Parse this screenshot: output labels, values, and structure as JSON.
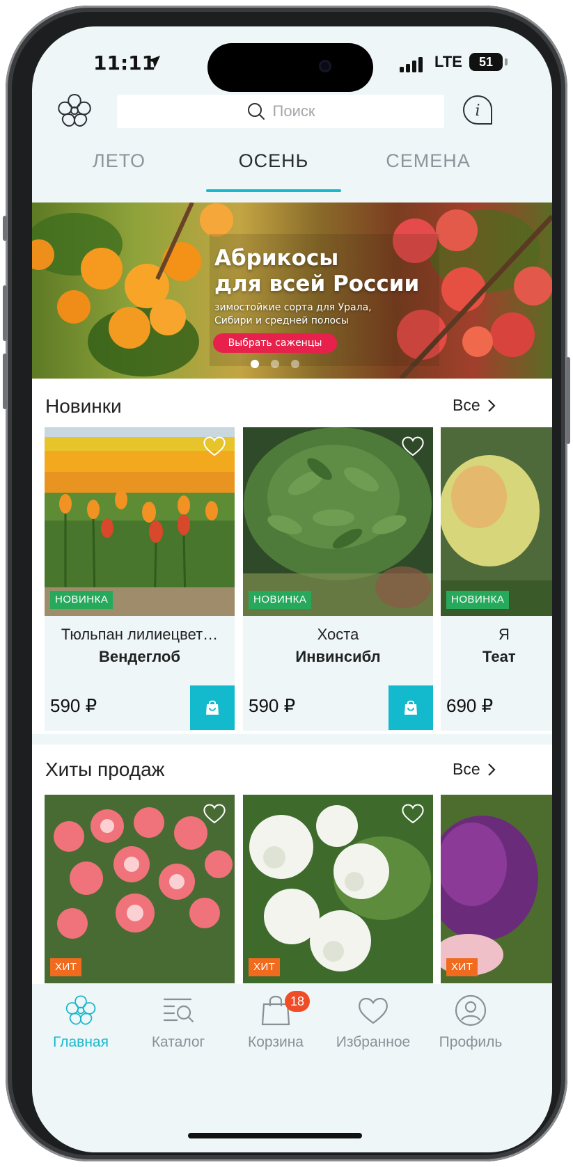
{
  "status_bar": {
    "time": "11:11",
    "network": "LTE",
    "battery": "51"
  },
  "header": {
    "search_placeholder": "Поиск"
  },
  "tabs": [
    {
      "label": "ЛЕТО"
    },
    {
      "label": "ОСЕНЬ",
      "active": true
    },
    {
      "label": "СЕМЕНА"
    }
  ],
  "banner": {
    "title_line1": "Абрикосы",
    "title_line2": "для всей России",
    "subtitle_line1": "зимостойкие сорта для Урала,",
    "subtitle_line2": "Сибири и средней полосы",
    "cta": "Выбрать саженцы",
    "slides_total": 3,
    "active_slide": 1
  },
  "sections": {
    "new": {
      "title": "Новинки",
      "all_label": "Все",
      "products": [
        {
          "badge": "НОВИНКА",
          "name1": "Тюльпан лилиецвет…",
          "name2": "Вендеглоб",
          "price": "590 ₽"
        },
        {
          "badge": "НОВИНКА",
          "name1": "Хоста",
          "name2": "Инвинсибл",
          "price": "590 ₽"
        },
        {
          "badge": "НОВИНКА",
          "name1": "Я",
          "name2": "Теат",
          "price": "690 ₽"
        }
      ]
    },
    "hits": {
      "title": "Хиты продаж",
      "all_label": "Все",
      "products": [
        {
          "badge": "ХИТ"
        },
        {
          "badge": "ХИТ"
        },
        {
          "badge": "ХИТ"
        }
      ]
    }
  },
  "bottom_nav": [
    {
      "label": "Главная",
      "icon": "flower-icon",
      "active": true
    },
    {
      "label": "Каталог",
      "icon": "catalog-search-icon"
    },
    {
      "label": "Корзина",
      "icon": "shopping-bag-icon",
      "badge": "18"
    },
    {
      "label": "Избранное",
      "icon": "heart-icon"
    },
    {
      "label": "Профиль",
      "icon": "profile-icon"
    }
  ],
  "colors": {
    "accent": "#16b8ca",
    "new_badge": "#27a95c",
    "hit_badge": "#f06b1e",
    "cart_badge": "#f04c26",
    "banner_cta": "#e7214b"
  }
}
